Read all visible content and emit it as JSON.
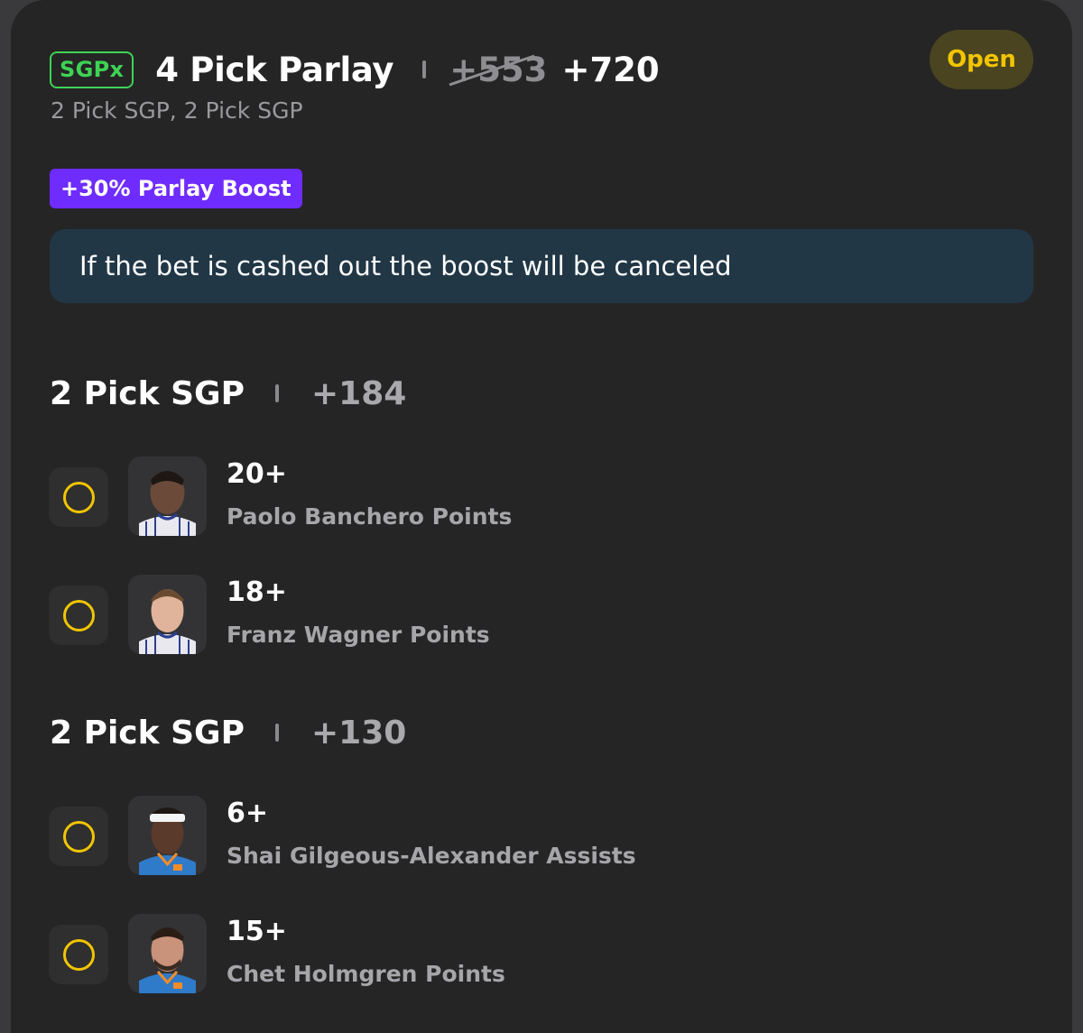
{
  "bet": {
    "badge": "SGPx",
    "title": "4 Pick Parlay",
    "old_odds": "+553",
    "new_odds": "+720",
    "subtitle": "2 Pick SGP, 2 Pick SGP",
    "status": "Open",
    "boost": "+30% Parlay Boost",
    "notice": "If the bet is cashed out the boost will be canceled"
  },
  "groups": [
    {
      "title": "2 Pick SGP",
      "odds": "+184",
      "picks": [
        {
          "line": "20+",
          "market": "Paolo Banchero Points",
          "jersey": "orlando-pinstripe"
        },
        {
          "line": "18+",
          "market": "Franz Wagner Points",
          "jersey": "orlando-pinstripe"
        }
      ]
    },
    {
      "title": "2 Pick SGP",
      "odds": "+130",
      "picks": [
        {
          "line": "6+",
          "market": "Shai Gilgeous-Alexander Assists",
          "jersey": "okc-blue"
        },
        {
          "line": "15+",
          "market": "Chet Holmgren Points",
          "jersey": "okc-blue"
        }
      ]
    }
  ],
  "colors": {
    "card_bg": "#252526",
    "sgpx_green": "#3ed354",
    "status_yellow": "#f1c500",
    "boost_purple": "#6f2cff",
    "notice_bg": "#213746"
  },
  "icons": {
    "pick_status": "pending-circle-icon",
    "player": "player-headshot"
  }
}
